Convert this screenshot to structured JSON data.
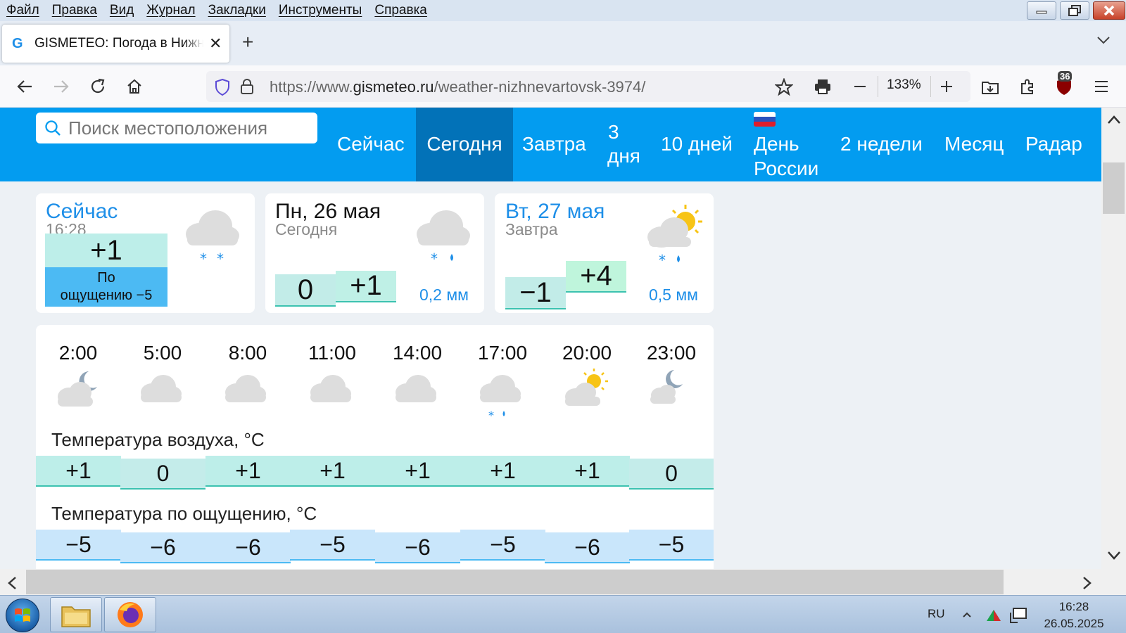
{
  "menubar": {
    "items": [
      "Файл",
      "Правка",
      "Вид",
      "Журнал",
      "Закладки",
      "Инструменты",
      "Справка"
    ]
  },
  "tab": {
    "favicon": "G",
    "title": "GISMETEO: Погода в Нижневартовске"
  },
  "urlbar": {
    "prefix": "https://www.",
    "host": "gismeteo.ru",
    "path": "/weather-nizhnevartovsk-3974/"
  },
  "toolbar": {
    "zoom": "133%",
    "ublock_badge": "36"
  },
  "site": {
    "search_placeholder": "Поиск местоположения",
    "nav": [
      "Сейчас",
      "Сегодня",
      "Завтра",
      "3",
      "дня",
      "10 дней",
      "День",
      "России",
      "2 недели",
      "Месяц",
      "Радар"
    ],
    "active_nav": "Сегодня"
  },
  "now": {
    "title": "Сейчас",
    "time": "16:28",
    "temp": "+1",
    "feels_label": "По",
    "feels_value": "ощущению −5",
    "icon": "cloud-snow-icon"
  },
  "today": {
    "title": "Пн, 26 мая",
    "subtitle": "Сегодня",
    "min": "0",
    "max": "+1",
    "precip": "0,2 мм",
    "icon": "cloud-snow-rain-icon"
  },
  "tomorrow": {
    "title": "Вт, 27 мая",
    "subtitle": "Завтра",
    "min": "−1",
    "max": "+4",
    "precip": "0,5 мм",
    "icon": "partly-sunny-snow-rain-icon"
  },
  "hourly": {
    "hours": [
      "2:00",
      "5:00",
      "8:00",
      "11:00",
      "14:00",
      "17:00",
      "20:00",
      "23:00"
    ],
    "icons": [
      "moon-cloud-icon",
      "cloud-icon",
      "cloud-icon",
      "cloud-icon",
      "cloud-icon",
      "cloud-snow-rain-icon",
      "sun-cloud-icon",
      "moon-cloud-icon"
    ],
    "air_title": "Температура воздуха, °C",
    "air": [
      "+1",
      "0",
      "+1",
      "+1",
      "+1",
      "+1",
      "+1",
      "0"
    ],
    "feels_title": "Температура по ощущению, °C",
    "feels": [
      "−5",
      "−6",
      "−6",
      "−5",
      "−6",
      "−5",
      "−6",
      "−5"
    ]
  },
  "taskbar": {
    "lang": "RU",
    "time": "16:28",
    "date": "26.05.2025"
  }
}
